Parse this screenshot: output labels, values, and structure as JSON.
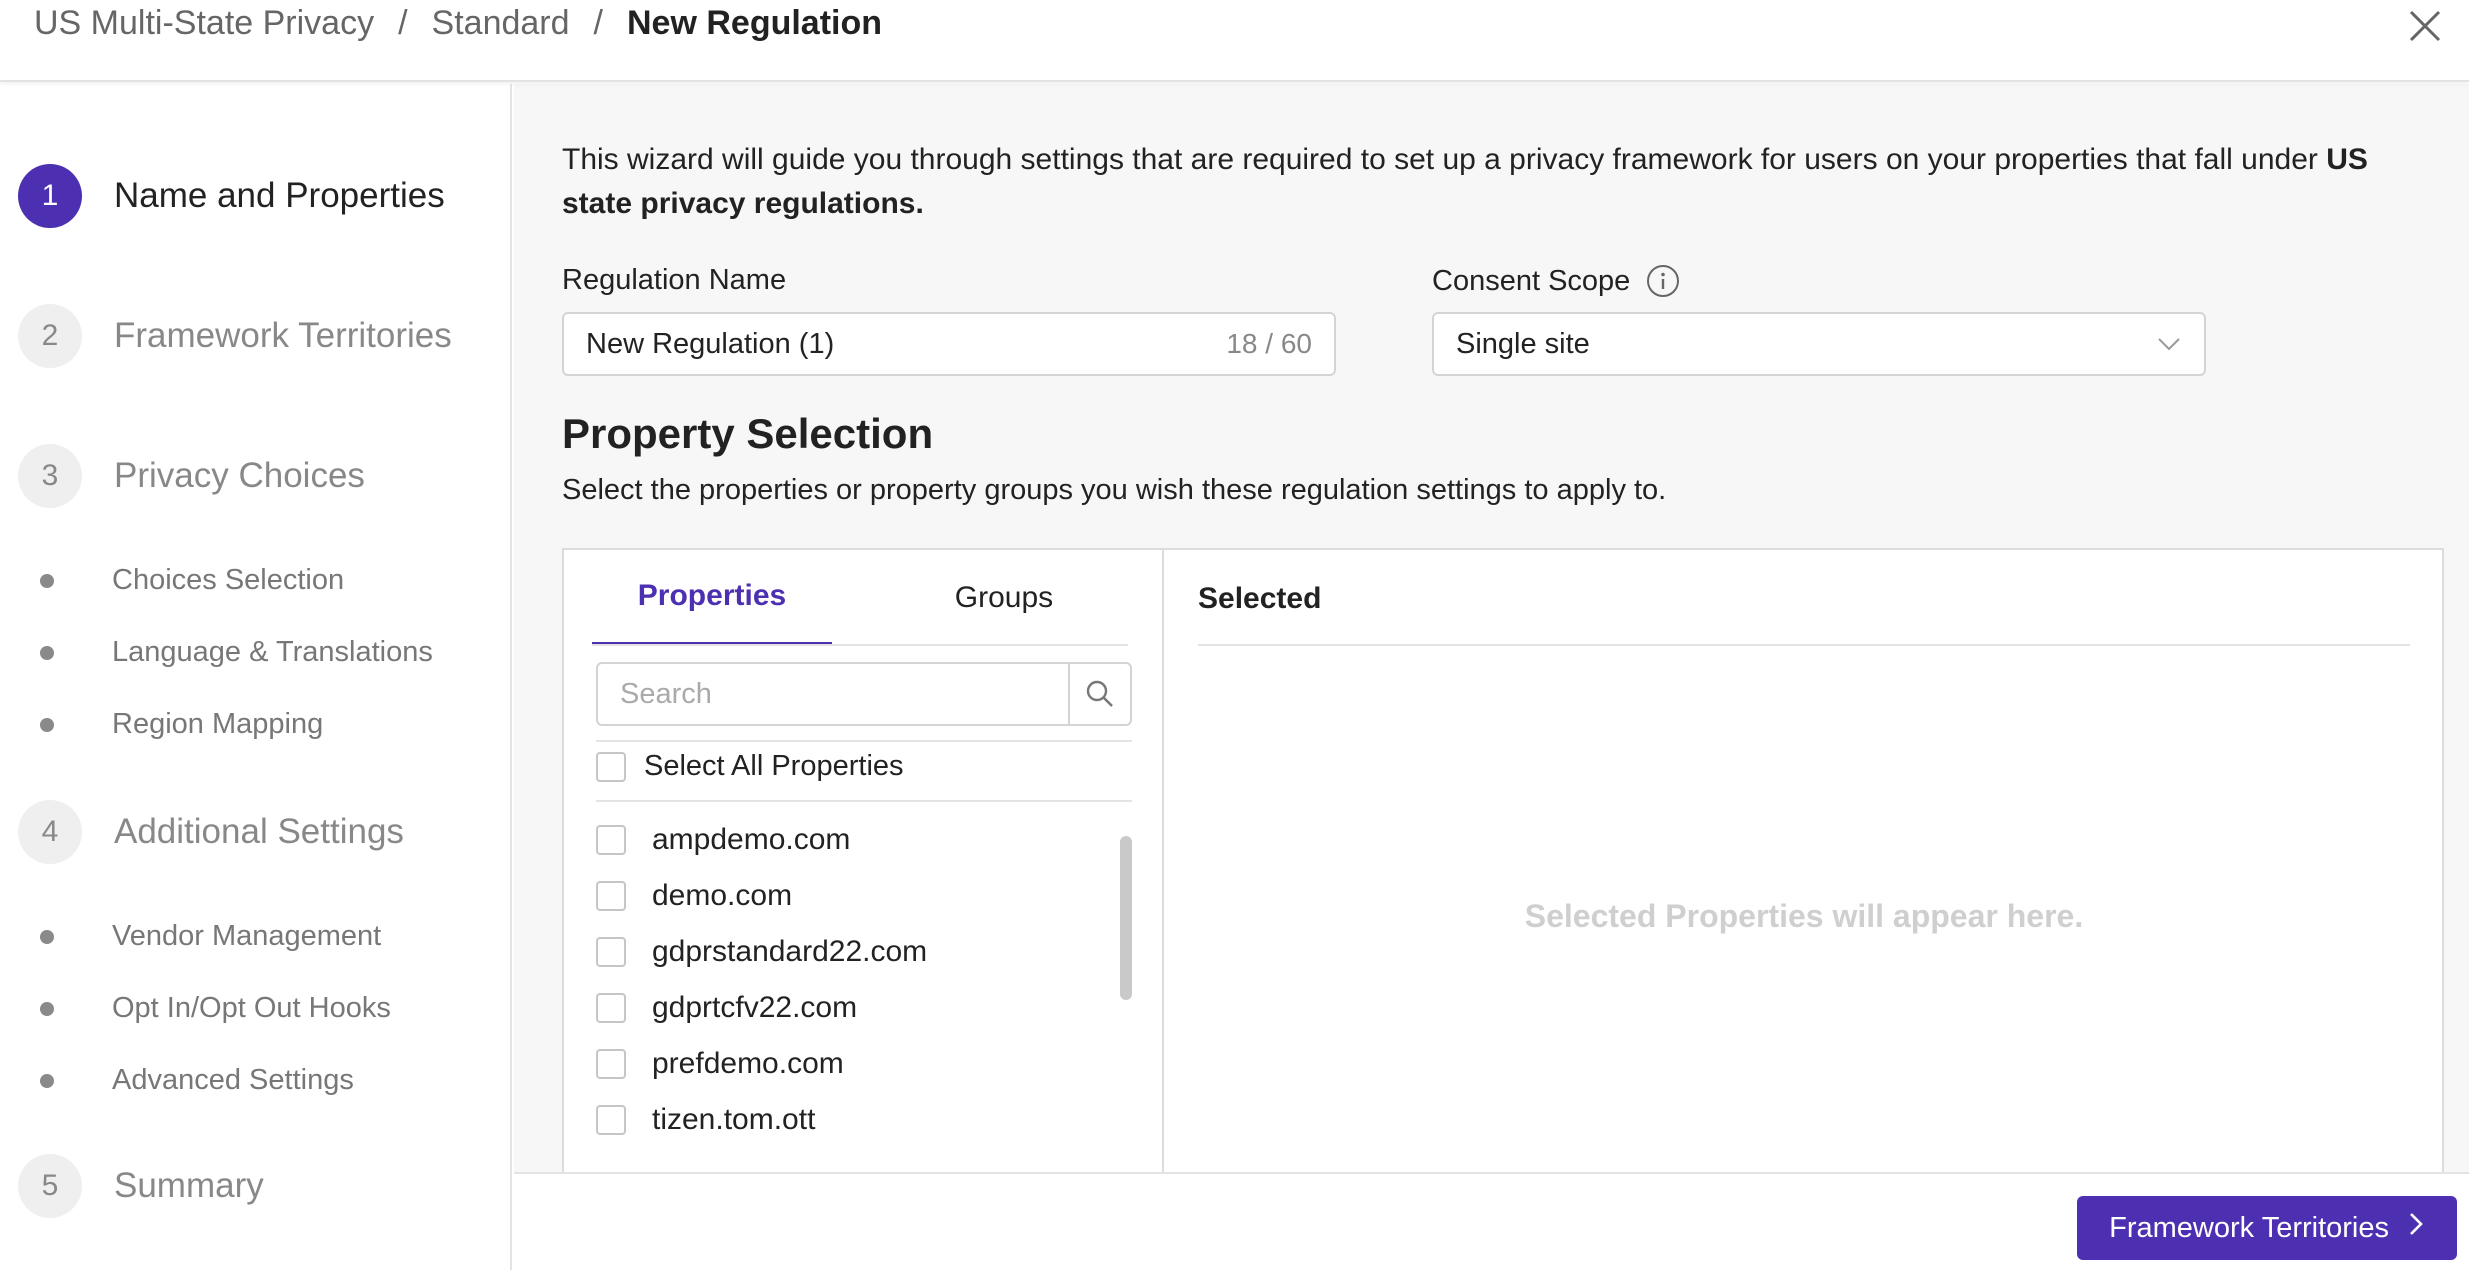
{
  "breadcrumb": {
    "items": [
      "US Multi-State Privacy",
      "Standard"
    ],
    "current": "New Regulation",
    "separator": "/"
  },
  "header": {
    "close_icon": "close-icon"
  },
  "sidebar": {
    "steps": [
      {
        "number": "1",
        "label": "Name and Properties"
      },
      {
        "number": "2",
        "label": "Framework Territories"
      },
      {
        "number": "3",
        "label": "Privacy Choices"
      },
      {
        "number": "4",
        "label": "Additional Settings"
      },
      {
        "number": "5",
        "label": "Summary"
      }
    ],
    "substeps_3": [
      "Choices Selection",
      "Language & Translations",
      "Region Mapping"
    ],
    "substeps_4": [
      "Vendor Management",
      "Opt In/Opt Out Hooks",
      "Advanced Settings"
    ]
  },
  "main": {
    "intro_text": "This wizard will guide you through settings that are required to set up a privacy framework for users on your properties that fall under ",
    "intro_bold": "US state privacy regulations.",
    "regulation_name": {
      "label": "Regulation Name",
      "value": "New Regulation (1)",
      "counter": "18 / 60"
    },
    "consent_scope": {
      "label": "Consent Scope",
      "value": "Single site",
      "info_icon": "info-icon"
    },
    "property_selection": {
      "title": "Property Selection",
      "subtitle": "Select the properties or property groups you wish these regulation settings to apply to.",
      "tabs": [
        "Properties",
        "Groups"
      ],
      "active_tab": "Properties",
      "search_placeholder": "Search",
      "select_all_label": "Select All Properties",
      "properties": [
        "ampdemo.com",
        "demo.com",
        "gdprstandard22.com",
        "gdprtcfv22.com",
        "prefdemo.com",
        "tizen.tom.ott"
      ],
      "selected_title": "Selected",
      "selected_empty": "Selected Properties will appear here."
    }
  },
  "footer": {
    "next_label": "Framework Territories"
  },
  "colors": {
    "accent": "#4d2fb1",
    "background": "#f7f7f7",
    "muted": "#888888"
  }
}
